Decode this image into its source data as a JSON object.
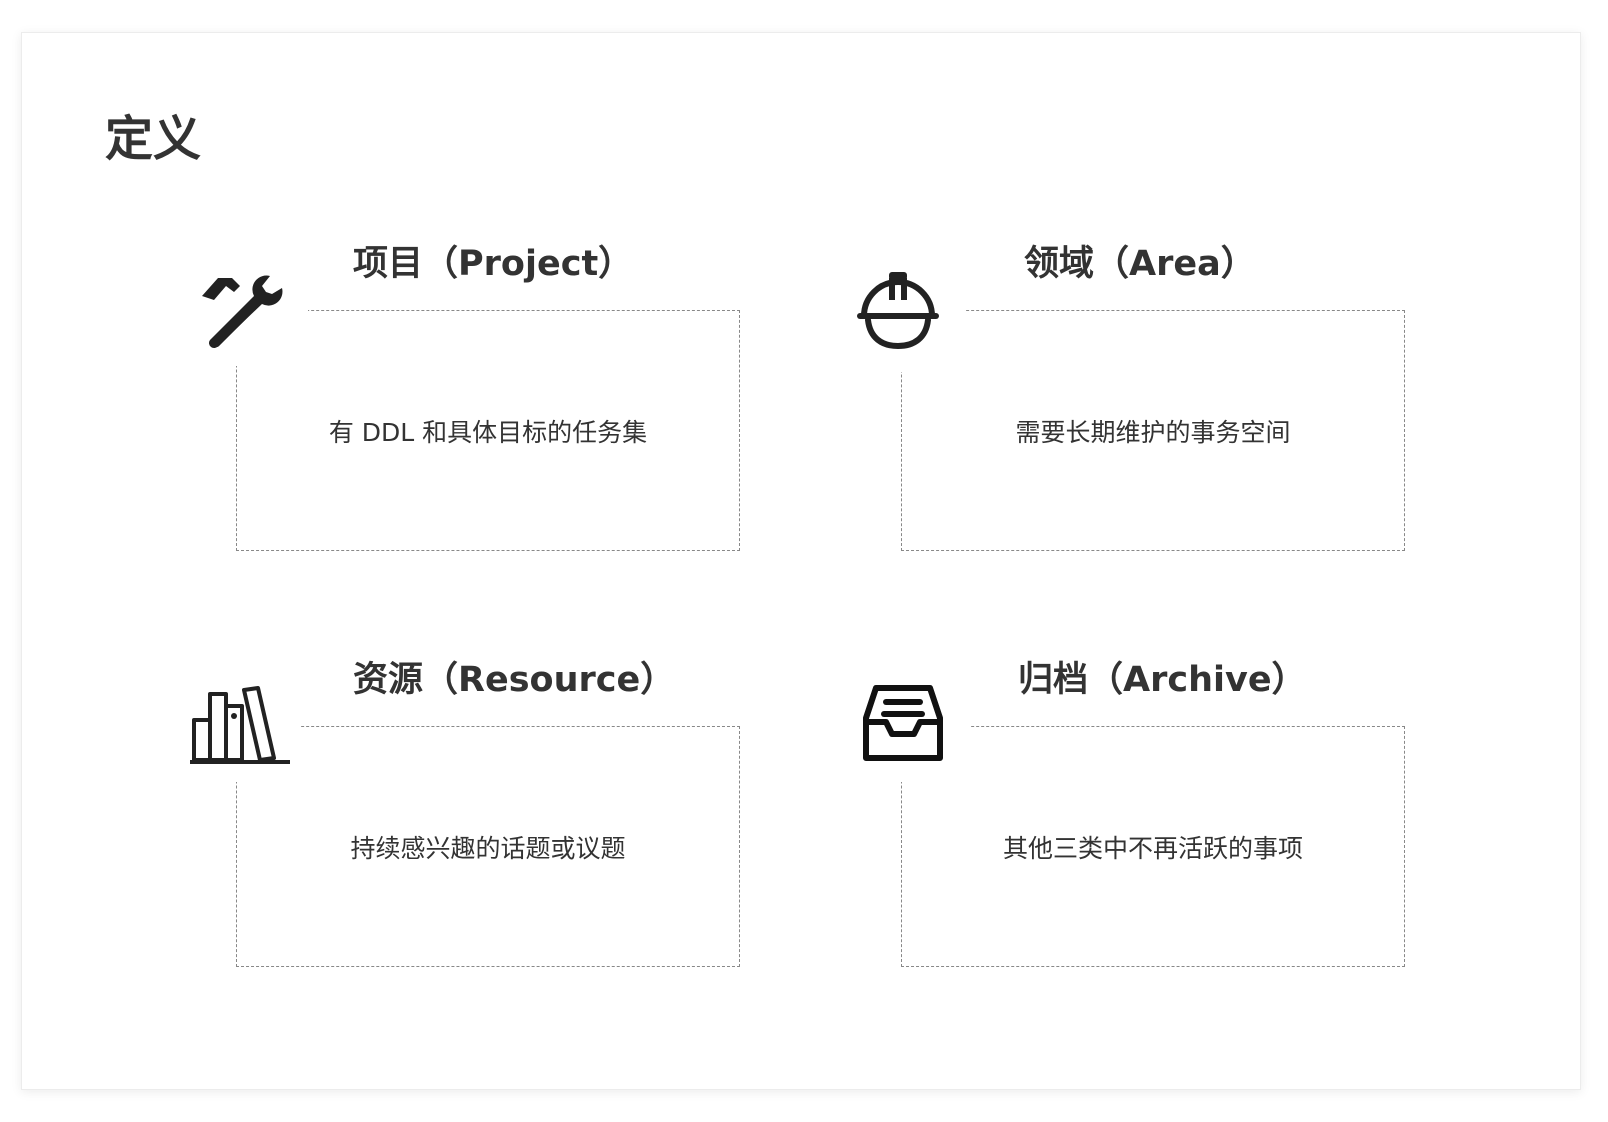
{
  "page_title": "定义",
  "quadrants": [
    {
      "id": "project",
      "title": "项目（Project）",
      "description": "有 DDL 和具体目标的任务集",
      "icon": "hammer-wrench-icon"
    },
    {
      "id": "area",
      "title": "领域（Area）",
      "description": "需要长期维护的事务空间",
      "icon": "hard-hat-icon"
    },
    {
      "id": "resource",
      "title": "资源（Resource）",
      "description": "持续感兴趣的话题或议题",
      "icon": "books-icon"
    },
    {
      "id": "archive",
      "title": "归档（Archive）",
      "description": "其他三类中不再活跃的事项",
      "icon": "archive-tray-icon"
    }
  ],
  "colors": {
    "text": "#333333",
    "border": "#888888",
    "icon": "#222222"
  }
}
